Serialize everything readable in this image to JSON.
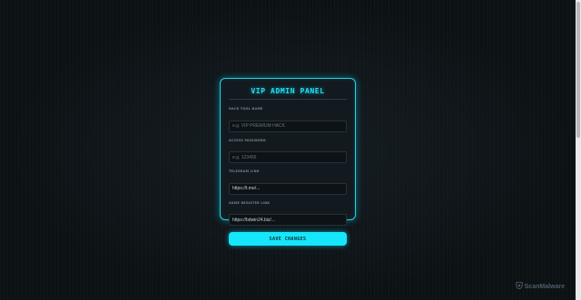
{
  "panel": {
    "title": "VIP ADMIN PANEL",
    "fields": [
      {
        "label": "HACK TOOL NAME",
        "placeholder": "e.g. VIP PREMIUM HACK",
        "value": ""
      },
      {
        "label": "ACCESS PASSWORD",
        "placeholder": "e.g. 123456",
        "value": ""
      },
      {
        "label": "TELEGRAM LINK",
        "placeholder": "",
        "value": "https://t.me/..."
      },
      {
        "label": "GAME REGISTER LINK",
        "placeholder": "",
        "value": "https://bdwin24.biz/..."
      }
    ],
    "save_label": "SAVE CHANGES"
  },
  "watermark": {
    "text": "ScanMalware",
    "icon": "scanmalware-logo-icon"
  },
  "colors": {
    "accent": "#22e0f5",
    "button": "#16e6fb",
    "background": "#0c1114",
    "panel": "#131a1f"
  }
}
